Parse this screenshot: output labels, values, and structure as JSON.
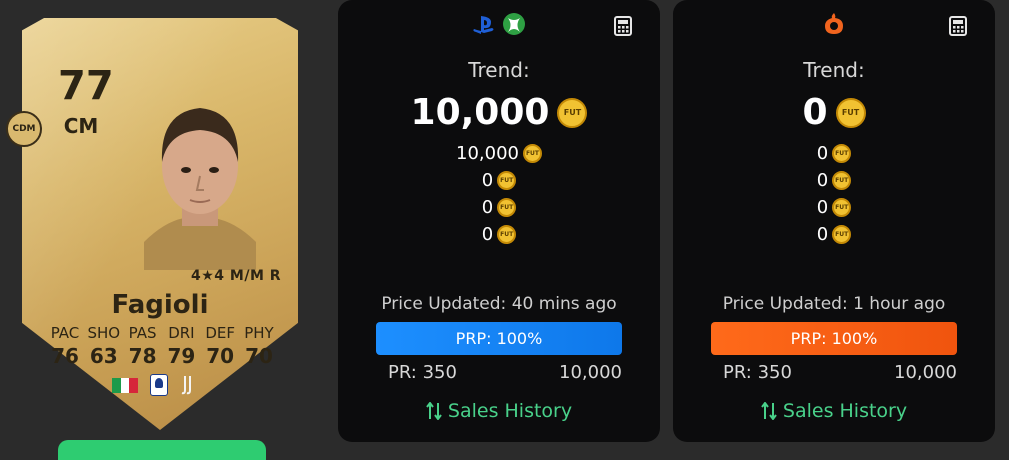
{
  "card": {
    "rating": "77",
    "position": "CM",
    "alt_position": "CDM",
    "skills": "4★4 M/M R",
    "name": "Fagioli",
    "stats": [
      {
        "label": "PAC",
        "value": "76"
      },
      {
        "label": "SHO",
        "value": "63"
      },
      {
        "label": "PAS",
        "value": "78"
      },
      {
        "label": "DRI",
        "value": "79"
      },
      {
        "label": "DEF",
        "value": "70"
      },
      {
        "label": "PHY",
        "value": "70"
      }
    ],
    "nation": "italy-flag",
    "league": "serie-a-logo",
    "club": "juventus-logo"
  },
  "panels": [
    {
      "platform": "console",
      "icons": [
        "playstation-icon",
        "xbox-icon"
      ],
      "trend_label": "Trend:",
      "main_price": "10,000",
      "coin_text": "FUT",
      "prices": [
        "10,000",
        "0",
        "0",
        "0"
      ],
      "updated": "Price Updated: 40 mins ago",
      "prp": "PRP: 100%",
      "pr_label": "PR: 350",
      "pr_max": "10,000",
      "sales_label": "Sales History",
      "accent": "#1d8fff"
    },
    {
      "platform": "pc",
      "icons": [
        "origin-icon"
      ],
      "trend_label": "Trend:",
      "main_price": "0",
      "coin_text": "FUT",
      "prices": [
        "0",
        "0",
        "0",
        "0"
      ],
      "updated": "Price Updated: 1 hour ago",
      "prp": "PRP: 100%",
      "pr_label": "PR: 350",
      "pr_max": "10,000",
      "sales_label": "Sales History",
      "accent": "#ff6a1a"
    }
  ],
  "colors": {
    "card_gold": "#d9b76a",
    "coin": "#f1c232",
    "sales_green": "#49d18a",
    "panel_bg": "#0c0c0d"
  }
}
